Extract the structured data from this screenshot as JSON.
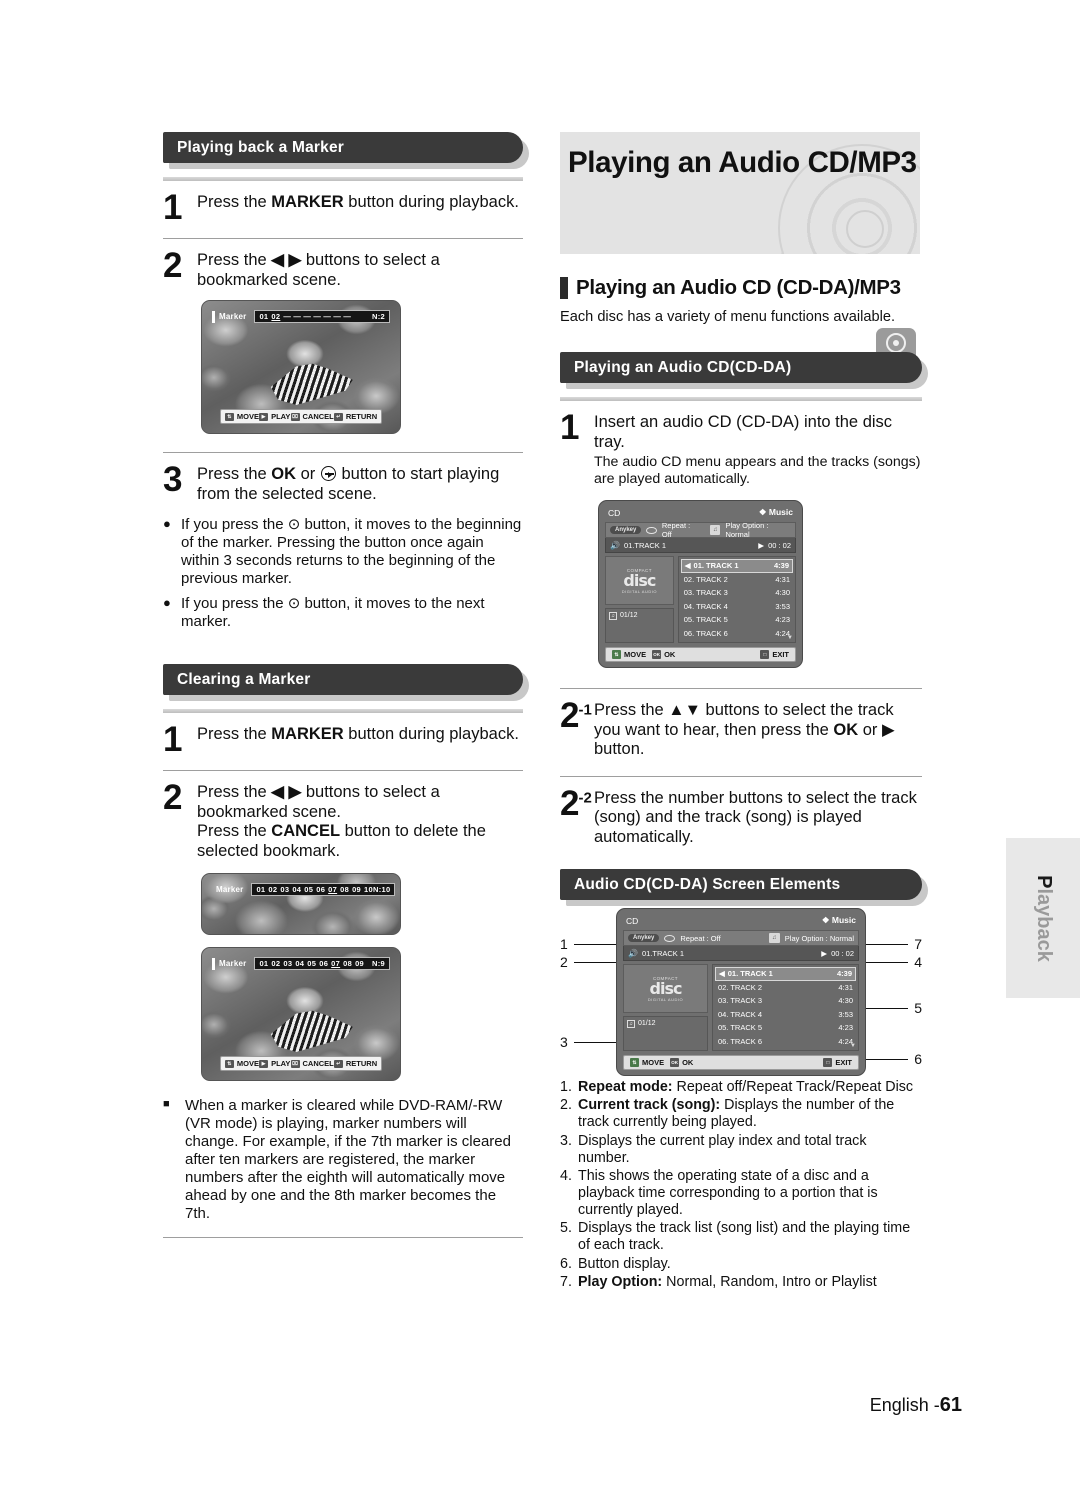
{
  "page": {
    "footer_label": "English -",
    "footer_number": "61",
    "side_tab": "Playback"
  },
  "banner": {
    "title": "Playing an Audio CD/MP3",
    "badge_label": "CD"
  },
  "left_column": {
    "section1": {
      "heading": "Playing back a Marker",
      "steps": [
        {
          "num": "1",
          "text_a": "Press the ",
          "bold": "MARKER",
          "text_b": " button during playback."
        },
        {
          "num": "2",
          "text_a": "Press the ",
          "glyph": "◀ ▶",
          "text_b": " buttons to select a bookmarked scene."
        }
      ],
      "screen": {
        "osd_label": "Marker",
        "markers": [
          "01",
          "02",
          "—",
          "—",
          "—",
          "—",
          "—",
          "—",
          "—",
          "—"
        ],
        "selected_marker": "02",
        "count_label": "N:2",
        "buttons": [
          {
            "icon": "⇅",
            "label": "MOVE"
          },
          {
            "icon": "▶",
            "label": "PLAY"
          },
          {
            "icon": "⌧",
            "label": "CANCEL"
          },
          {
            "icon": "↵",
            "label": "RETURN"
          }
        ]
      },
      "step3": {
        "num": "3",
        "text_a": "Press the ",
        "bold": "OK",
        "text_b": " or ",
        "text_c": " button to start playing from the selected scene."
      },
      "notes": [
        "If you press the ⊙ button, it moves to the beginning of the marker. Pressing the button once again within 3 seconds returns to the beginning of the previous marker.",
        "If you press the ⊙ button, it moves to the next marker."
      ]
    },
    "section2": {
      "heading": "Clearing a Marker",
      "steps": [
        {
          "num": "1",
          "text_a": "Press the ",
          "bold": "MARKER",
          "text_b": " button during playback."
        },
        {
          "num": "2",
          "text_a": "Press the ",
          "glyph": "◀ ▶",
          "text_b": " buttons to select a bookmarked scene."
        }
      ],
      "step2_extra_a": "Press the ",
      "step2_extra_bold": "CANCEL",
      "step2_extra_b": " button to delete the selected bookmark.",
      "screen_a": {
        "osd_label": "Marker",
        "markers": [
          "01",
          "02",
          "03",
          "04",
          "05",
          "06",
          "07",
          "08",
          "09",
          "10"
        ],
        "selected_marker": "07",
        "count_label": "N:10"
      },
      "screen_b": {
        "osd_label": "Marker",
        "markers": [
          "01",
          "02",
          "03",
          "04",
          "05",
          "06",
          "07",
          "08",
          "09"
        ],
        "selected_marker": "07",
        "count_label": "N:9",
        "buttons": [
          {
            "icon": "⇅",
            "label": "MOVE"
          },
          {
            "icon": "▶",
            "label": "PLAY"
          },
          {
            "icon": "⌧",
            "label": "CANCEL"
          },
          {
            "icon": "↵",
            "label": "RETURN"
          }
        ]
      },
      "note": "When a marker is cleared while DVD-RAM/-RW (VR mode) is playing, marker numbers will change. For example, if the 7th marker is cleared after ten markers are registered, the marker numbers after the eighth will automatically move ahead by one and the 8th marker becomes the 7th."
    }
  },
  "right_column": {
    "subhead": "Playing an Audio CD (CD-DA)/MP3",
    "lead": "Each disc has a variety of menu functions available.",
    "section1": {
      "heading": "Playing an Audio CD(CD-DA)",
      "step1_num": "1",
      "step1_text": "Insert an audio CD (CD-DA) into the disc tray.",
      "step1_sub": "The audio CD menu appears and the tracks (songs) are played automatically."
    },
    "cd_screen": {
      "title": "CD",
      "music_label": "❖ Music",
      "anykey": "Anykey",
      "repeat": "Repeat : Off",
      "play_option": "Play Option : Normal",
      "current_track": "01.TRACK 1",
      "elapsed": "00 : 02",
      "disc_logo_top": "COMPACT",
      "disc_logo_word": "disc",
      "disc_logo_bottom": "DIGITAL AUDIO",
      "index": "01/12",
      "tracks": [
        {
          "name": "01. TRACK 1",
          "time": "4:39",
          "selected": true
        },
        {
          "name": "02. TRACK 2",
          "time": "4:31",
          "selected": false
        },
        {
          "name": "03. TRACK 3",
          "time": "4:30",
          "selected": false
        },
        {
          "name": "04. TRACK 4",
          "time": "3:53",
          "selected": false
        },
        {
          "name": "05. TRACK 5",
          "time": "4:23",
          "selected": false
        },
        {
          "name": "06. TRACK 6",
          "time": "4:24",
          "selected": false
        }
      ],
      "buttons": [
        {
          "icon": "⇅",
          "label": "MOVE"
        },
        {
          "icon": "OK",
          "label": "OK"
        },
        {
          "icon": "□",
          "label": "EXIT"
        }
      ]
    },
    "step21": {
      "num": "2",
      "sup": "-1",
      "text_a": "Press the ",
      "glyph": "▲▼",
      "text_b": " buttons to select the track you want to hear,  then press the ",
      "bold": "OK",
      "text_c": " or ▶ button."
    },
    "step22": {
      "num": "2",
      "sup": "-2",
      "text": "Press the number buttons to select the track (song) and the track (song) is played automatically."
    },
    "section2": {
      "heading": "Audio CD(CD-DA) Screen Elements",
      "callout_numbers_left": [
        "1",
        "2",
        "3"
      ],
      "callout_numbers_right": [
        "7",
        "4",
        "5",
        "6"
      ],
      "legend": [
        {
          "n": "1.",
          "bold": "Repeat mode:",
          "text": " Repeat off/Repeat Track/Repeat Disc"
        },
        {
          "n": "2.",
          "bold": "Current track (song):",
          "text": " Displays the number of the track currently being played."
        },
        {
          "n": "3.",
          "bold": "",
          "text": "Displays the current play index and total track number."
        },
        {
          "n": "4.",
          "bold": "",
          "text": "This shows the operating state of a disc and a playback time corresponding to a portion that is currently played."
        },
        {
          "n": "5.",
          "bold": "",
          "text": "Displays the track list (song list) and the playing time of each track."
        },
        {
          "n": "6.",
          "bold": "",
          "text": "Button display."
        },
        {
          "n": "7.",
          "bold": "Play Option:",
          "text": " Normal, Random, Intro or Playlist"
        }
      ]
    }
  }
}
